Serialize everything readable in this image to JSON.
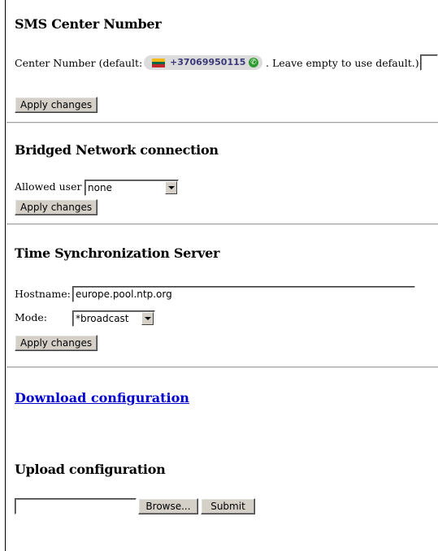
{
  "sms_center": {
    "title": "SMS Center Number",
    "label_prefix": "Center Number (default:",
    "default_number": "+37069950115",
    "label_suffix": ". Leave empty to use default.):",
    "input_value": "",
    "apply_label": "Apply changes",
    "flag_colors": [
      "#fdb913",
      "#006a44",
      "#c1272d"
    ]
  },
  "bridged": {
    "title": "Bridged Network connection",
    "allowed_user_label": "Allowed user",
    "allowed_user_value": "none",
    "apply_label": "Apply changes"
  },
  "time_sync": {
    "title": "Time Synchronization Server",
    "hostname_label": "Hostname:",
    "hostname_value": "europe.pool.ntp.org",
    "mode_label": "Mode:",
    "mode_value": "*broadcast",
    "apply_label": "Apply changes"
  },
  "download": {
    "link_text": "Download configuration"
  },
  "upload": {
    "title": "Upload configuration",
    "file_value": "",
    "browse_label": "Browse...",
    "submit_label": "Submit"
  }
}
